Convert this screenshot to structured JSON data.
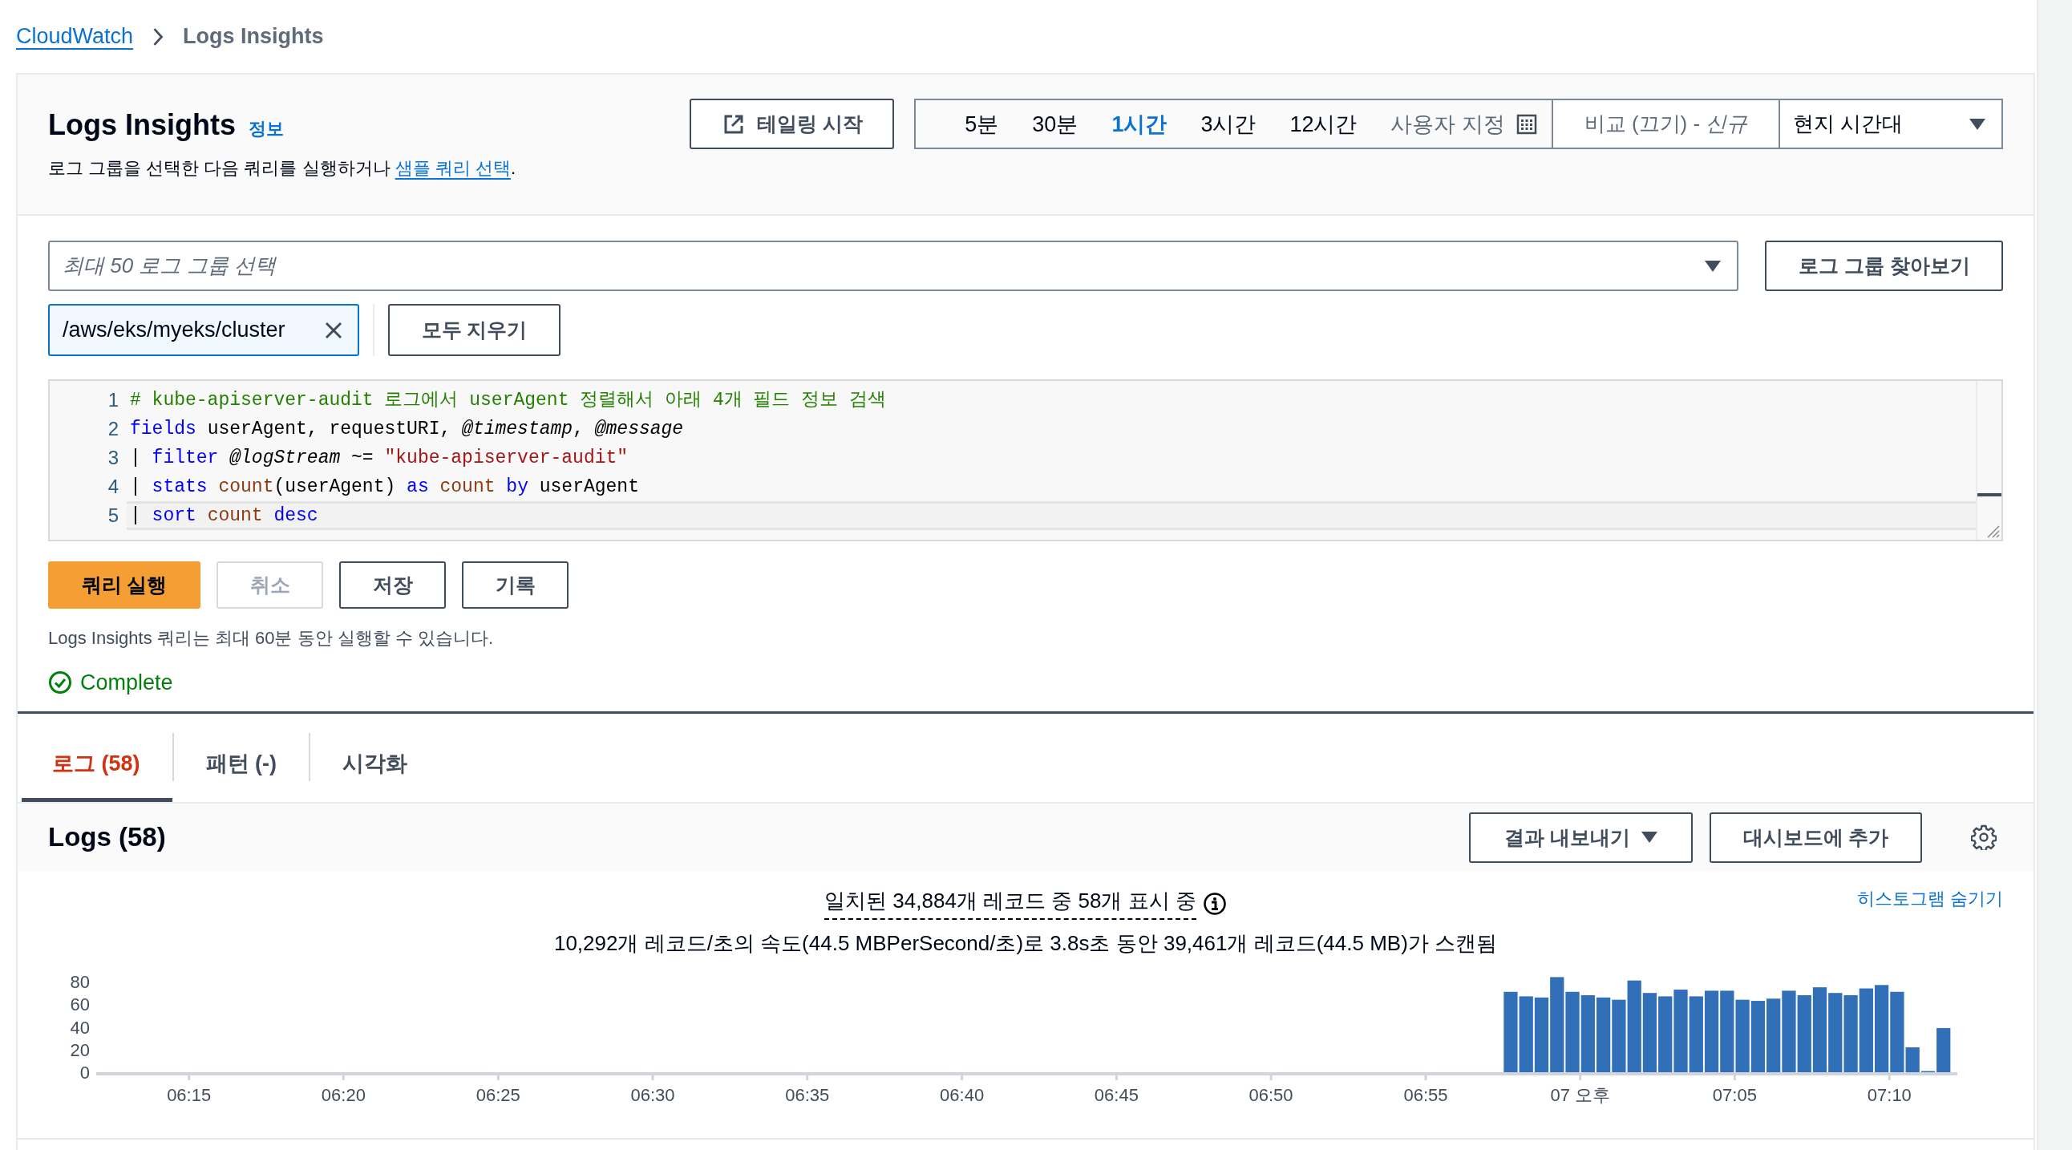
{
  "breadcrumbs": [
    {
      "label": "CloudWatch",
      "kind": "link"
    },
    {
      "label": "Logs Insights",
      "kind": "current"
    }
  ],
  "header": {
    "title": "Logs Insights",
    "info_link": "정보",
    "description": "로그 그룹을 선택한 다음 쿼리를 실행하거나 ",
    "description_link": "샘플 쿼리 선택",
    "description_end": "."
  },
  "tail_button": "테일링 시작",
  "time_ranges": [
    {
      "label": "5분",
      "selected": false
    },
    {
      "label": "30분",
      "selected": false
    },
    {
      "label": "1시간",
      "selected": true
    },
    {
      "label": "3시간",
      "selected": false
    },
    {
      "label": "12시간",
      "selected": false
    }
  ],
  "custom_range": "사용자 지정",
  "compare": "비교 (끄기) - *신규*",
  "timezone": "현지 시간대",
  "log_group_select": {
    "placeholder": "최대 50 로그 그룹 선택"
  },
  "browse_button": "로그 그룹 찾아보기",
  "selected_log_groups": [
    {
      "label": "/aws/eks/myeks/cluster"
    }
  ],
  "clear_all_button": "모두 지우기",
  "editor": {
    "lines": [
      {
        "number": "1",
        "active": false,
        "tokens": [
          {
            "text": "# kube-apiserver-audit 로그에서 userAgent 정렬해서 아래 4개 필드 정보 검색",
            "kind": "comment"
          }
        ]
      },
      {
        "number": "2",
        "active": false,
        "tokens": [
          {
            "text": "fields",
            "kind": "keyword"
          },
          {
            "text": " userAgent, requestURI, ",
            "kind": "plain"
          },
          {
            "text": "@timestamp",
            "kind": "field"
          },
          {
            "text": ", ",
            "kind": "plain"
          },
          {
            "text": "@message",
            "kind": "field"
          }
        ]
      },
      {
        "number": "3",
        "active": false,
        "tokens": [
          {
            "text": "| ",
            "kind": "plain"
          },
          {
            "text": "filter ",
            "kind": "keyword"
          },
          {
            "text": "@logStream",
            "kind": "field"
          },
          {
            "text": " ~= ",
            "kind": "plain"
          },
          {
            "text": "\"kube-apiserver-audit\"",
            "kind": "string"
          }
        ]
      },
      {
        "number": "4",
        "active": false,
        "tokens": [
          {
            "text": "| ",
            "kind": "plain"
          },
          {
            "text": "stats ",
            "kind": "keyword"
          },
          {
            "text": "count",
            "kind": "function"
          },
          {
            "text": "(userAgent) ",
            "kind": "plain"
          },
          {
            "text": "as ",
            "kind": "keyword"
          },
          {
            "text": "count ",
            "kind": "function"
          },
          {
            "text": "by",
            "kind": "keyword"
          },
          {
            "text": " userAgent",
            "kind": "plain"
          }
        ]
      },
      {
        "number": "5",
        "active": true,
        "tokens": [
          {
            "text": "| ",
            "kind": "plain"
          },
          {
            "text": "sort ",
            "kind": "keyword"
          },
          {
            "text": "count ",
            "kind": "function"
          },
          {
            "text": "desc",
            "kind": "keyword"
          }
        ]
      }
    ]
  },
  "actions": [
    {
      "label": "쿼리 실행",
      "kind": "primary",
      "disabled": false
    },
    {
      "label": "취소",
      "kind": "normal",
      "disabled": true
    },
    {
      "label": "저장",
      "kind": "normal",
      "disabled": false
    },
    {
      "label": "기록",
      "kind": "normal",
      "disabled": false
    }
  ],
  "note": "Logs Insights 쿼리는 최대 60분 동안 실행할 수 있습니다.",
  "status": {
    "label": "Complete",
    "kind": "success"
  },
  "result_tabs": [
    {
      "label": "로그 (58)",
      "selected": true
    },
    {
      "label": "패턴 (-)",
      "selected": false
    },
    {
      "label": "시각화",
      "selected": false
    }
  ],
  "logs_panel": {
    "title": "Logs (58)",
    "export_button": "결과 내보내기",
    "dashboard_button": "대시보드에 추가"
  },
  "histogram": {
    "summary": "일치된 34,884개 레코드 중 58개 표시 중",
    "scan_info": "10,292개 레코드/초의 속도(44.5 MBPerSecond/초)로 3.8s초 동안 39,461개 레코드(44.5 MB)가 스캔됨",
    "hide_link": "히스토그램 숨기기",
    "chart_data": {
      "type": "bar",
      "x": [
        6.9625,
        6.970833,
        6.979167,
        6.9875,
        6.995833,
        7.004167,
        7.0125,
        7.020833,
        7.029167,
        7.0375,
        7.045833,
        7.054167,
        7.0625,
        7.070833,
        7.079167,
        7.0875,
        7.095833,
        7.104167,
        7.1125,
        7.120833,
        7.129167,
        7.1375,
        7.145833,
        7.154167,
        7.1625,
        7.170833,
        7.179167,
        7.1875,
        7.195833
      ],
      "series": [
        {
          "color": "#3170b8",
          "values": [
            71,
            67,
            66,
            84,
            71,
            68,
            66,
            64,
            81,
            70,
            67,
            73,
            67,
            72,
            72,
            64,
            63,
            65,
            72,
            68,
            75,
            70,
            68,
            74,
            77,
            71,
            22,
            1,
            39
          ]
        }
      ],
      "xlim": [
        6.2,
        7.2033
      ],
      "ylim": [
        0,
        85
      ],
      "xticks": [
        {
          "value": 6.25,
          "label": "06:15"
        },
        {
          "value": 6.3333,
          "label": "06:20"
        },
        {
          "value": 6.4167,
          "label": "06:25"
        },
        {
          "value": 6.5,
          "label": "06:30"
        },
        {
          "value": 6.5833,
          "label": "06:35"
        },
        {
          "value": 6.6667,
          "label": "06:40"
        },
        {
          "value": 6.75,
          "label": "06:45"
        },
        {
          "value": 6.8333,
          "label": "06:50"
        },
        {
          "value": 6.9167,
          "label": "06:55"
        },
        {
          "value": 7,
          "label": "07 오후"
        },
        {
          "value": 7.0833,
          "label": "07:05"
        },
        {
          "value": 7.1667,
          "label": "07:10"
        }
      ],
      "yticks": [
        0,
        20,
        40,
        60,
        80
      ]
    }
  }
}
